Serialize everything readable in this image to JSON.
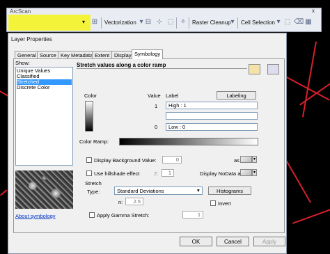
{
  "toolbar": {
    "title": "ArcScan",
    "close_label": "x",
    "select_value": "",
    "vectorization_label": "Vectorization",
    "raster_cleanup_label": "Raster Cleanup",
    "cell_selection_label": "Cell Selection",
    "highlight_color": "#f3f43a"
  },
  "dialog": {
    "title": "Layer Properties",
    "tabs": [
      "General",
      "Source",
      "Key Metadata",
      "Extent",
      "Display",
      "Symbology"
    ],
    "active_tab": "Symbology",
    "show_label": "Show:",
    "show_items": [
      "Unique Values",
      "Classified",
      "Stretched",
      "Discrete Color"
    ],
    "selected_show_item": "Stretched",
    "about_link": "About symbology",
    "description": "Stretch values along a color ramp",
    "color_header": "Color",
    "value_header": "Value",
    "label_header": "Label",
    "labeling_button": "Labeling",
    "high_value": "1",
    "high_label": "High : 1",
    "low_value": "0",
    "low_label": "Low : 0",
    "color_ramp_label": "Color Ramp:",
    "display_background_label": "Display Background Value:",
    "background_value": "0",
    "as_label": "as",
    "use_hillshade_label": "Use hillshade effect",
    "z_label": "Z:",
    "z_value": "1",
    "display_nodata_label": "Display NoData as",
    "stretch_group_label": "Stretch",
    "type_label": "Type:",
    "type_value": "Standard Deviations",
    "histograms_button": "Histograms",
    "n_label": "n:",
    "n_value": "2.5",
    "invert_label": "Invert",
    "gamma_label": "Apply Gamma Stretch:",
    "gamma_value": "1",
    "ok_button": "OK",
    "cancel_button": "Cancel",
    "apply_button": "Apply",
    "selection_color": "#3399ff"
  }
}
